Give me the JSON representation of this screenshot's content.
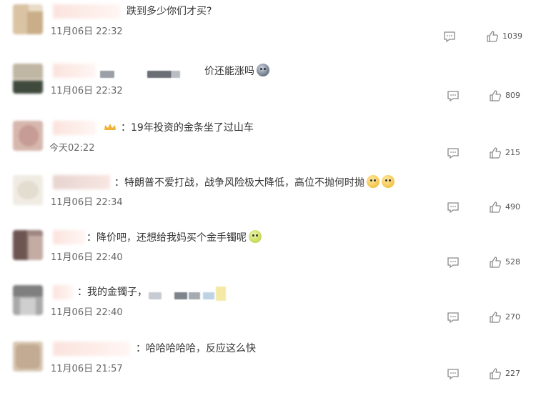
{
  "comments": [
    {
      "text": "跌到多少你们才买?",
      "time": "11月06日 22:32",
      "likes": "1039",
      "emoji": []
    },
    {
      "text": "价还能涨吗",
      "time": "11月06日 22:32",
      "likes": "809",
      "emoji": [
        "dark"
      ]
    },
    {
      "text": "19年投资的金条坐了过山车",
      "time": "今天02:22",
      "likes": "215",
      "emoji": []
    },
    {
      "text": "特朗普不爱打战，战争风险极大降低，高位不抛何时抛",
      "time": "11月06日 22:34",
      "likes": "490",
      "emoji": [
        "yellow",
        "yellow"
      ]
    },
    {
      "text": "降价吧，还想给我妈买个金手镯呢",
      "time": "11月06日 22:40",
      "likes": "528",
      "emoji": [
        "green"
      ]
    },
    {
      "text": "我的金镯子",
      "time": "11月06日 22:40",
      "likes": "270",
      "emoji": []
    },
    {
      "text": "哈哈哈哈哈，反应这么快",
      "time": "11月06日 21:57",
      "likes": "227",
      "emoji": []
    }
  ],
  "icons": {
    "reply": "comment-bubble-icon",
    "like": "thumbs-up-icon"
  },
  "colors": {
    "text": "#333333",
    "meta": "#666666",
    "icon": "#8a8a8a"
  }
}
